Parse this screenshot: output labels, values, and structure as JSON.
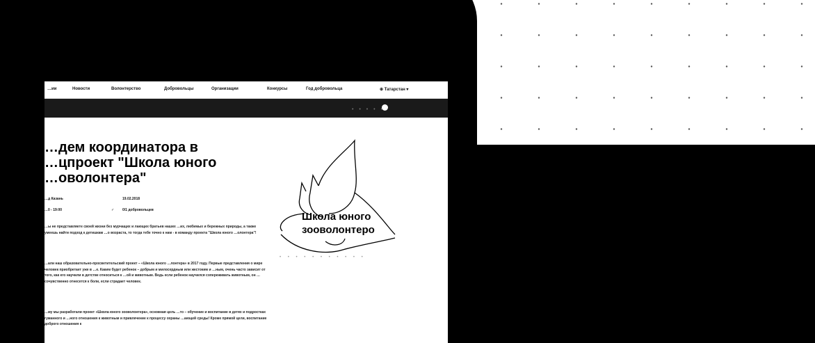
{
  "nav": {
    "items": [
      "…ии",
      "Новости",
      "Волонтерство",
      "Добровольцы",
      "Организации",
      "Конкурсы",
      "Год добровольца",
      "⊕ Татарстан ▾"
    ]
  },
  "article": {
    "title_lines": [
      "…дем координатора в",
      "…цпроект \"Школа юного",
      "…оволонтера\""
    ],
    "meta": {
      "organizer": "…д Казань",
      "date": "19.02.2018",
      "time": "…0 - 19:00",
      "volunteers": "0/1 добровольцев"
    },
    "paragraphs": [
      "…ы не представляете своей жизни без мурчащих и лающих братьев наших …их, любимых и бережных природы, а также умеешь найти подход к детишкам …о возраста, то тогда тебе точно к нам - в команду проекта \"Школа юного …олонтера\"!",
      "…али наш образовательно-просветительский проект – «Школа юного …лонтера» в 2017 году. Первые представления о мире человек приобретает уже в …е. Каким будет ребенок – добрым и милосердным или жестоким и …ным, очень часто зависит от того, как его научили в детстве относиться к …ой и животным. Ведь если ребенок научился сопереживать животным, он …сочувственно отнесется к боли, если страдает человек.",
      "…му мы разработали проект «Школа юного зооволонтера», основная цель …то – обучение и воспитание в детях и подростках гуманного и …ного отношения к животным и привлечение к процессу охраны …ающей среды! Кроме прямой цели, воспитание доброго отношения к"
    ]
  },
  "logo": {
    "line1": "Школа юного",
    "line2": "зооволонтеро"
  }
}
